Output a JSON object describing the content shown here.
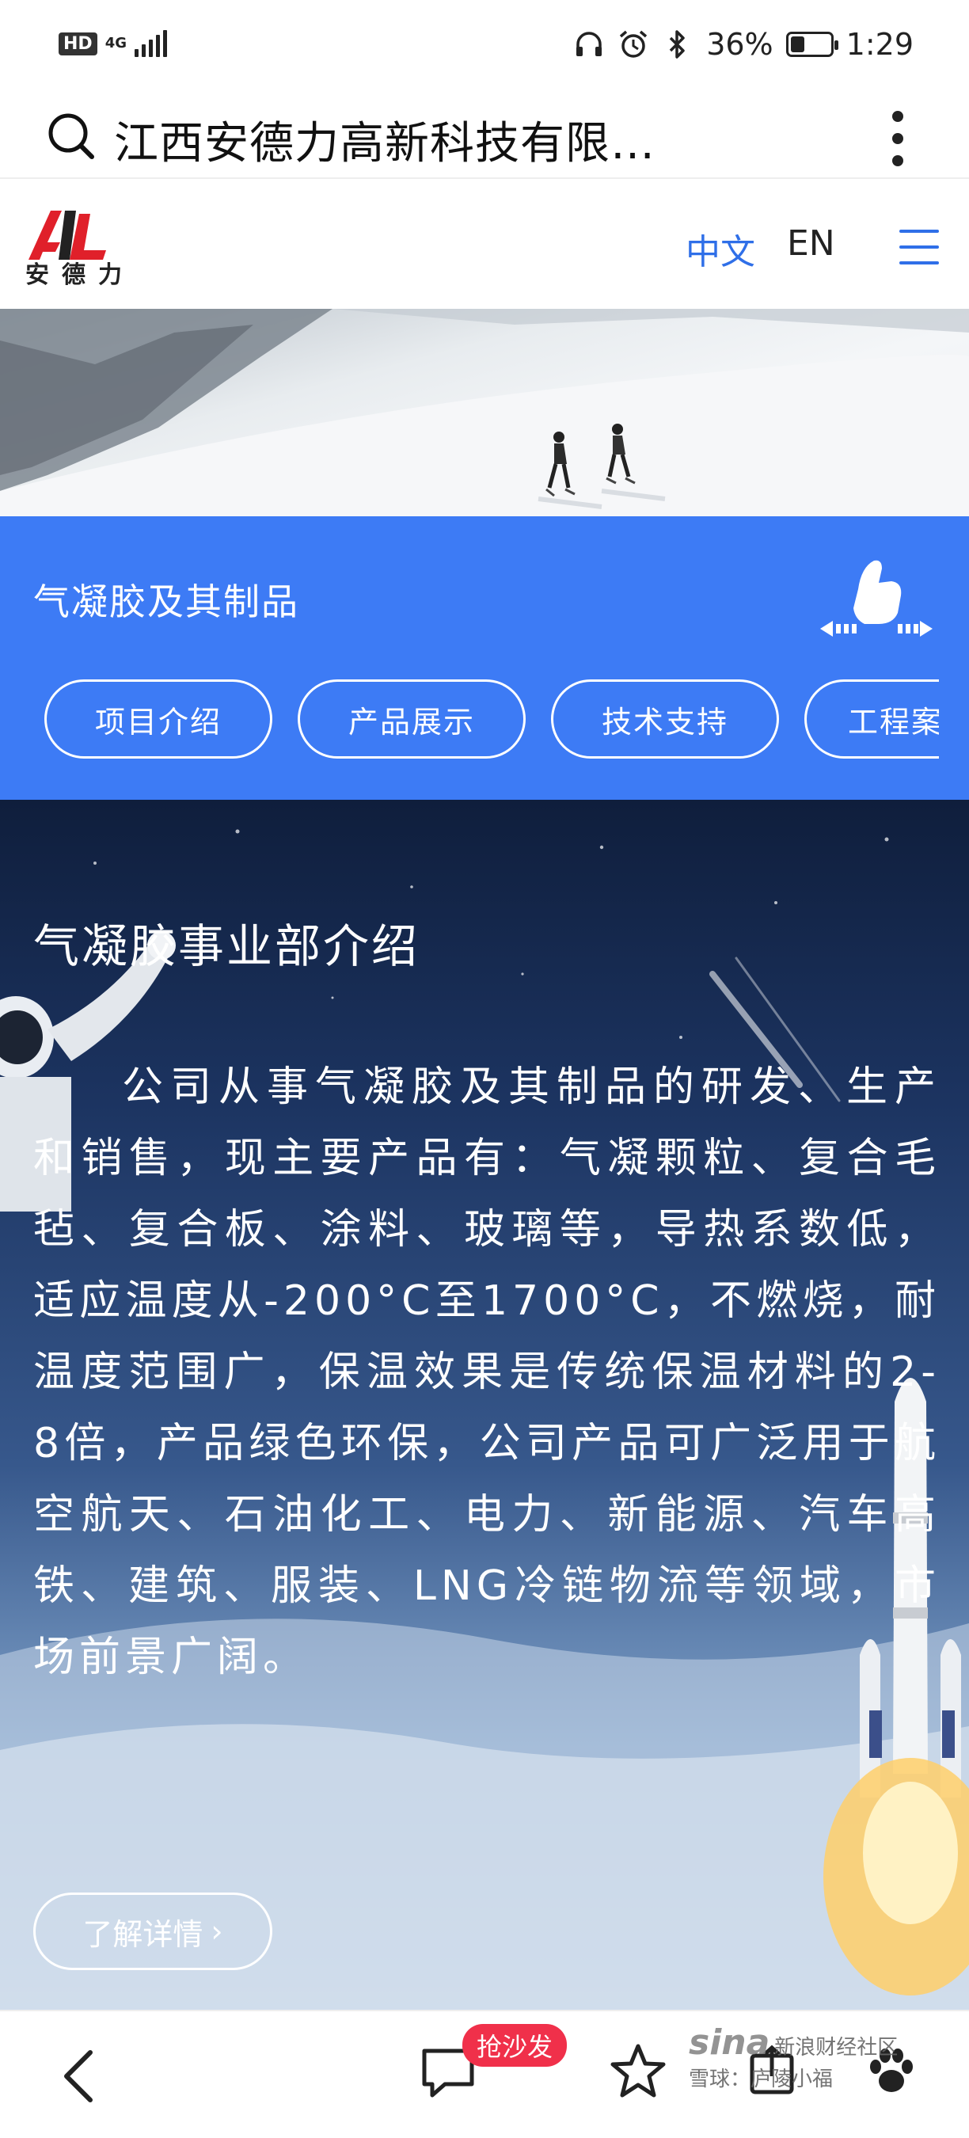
{
  "status_bar": {
    "hd": "HD",
    "network": "4G",
    "battery": "36%",
    "battery_level": 0.36,
    "time": "1:29"
  },
  "browser": {
    "address_title": "江西安德力高新科技有限…"
  },
  "site": {
    "logo_text": "安德力",
    "lang_zh": "中文",
    "lang_en": "EN"
  },
  "section": {
    "title": "气凝胶及其制品",
    "tabs": [
      {
        "label": "项目介绍"
      },
      {
        "label": "产品展示"
      },
      {
        "label": "技术支持"
      },
      {
        "label": "工程案"
      }
    ]
  },
  "intro": {
    "title": "气凝胶事业部介绍",
    "body": "公司从事气凝胶及其制品的研发、生产和销售，现主要产品有：气凝颗粒、复合毛毡、复合板、涂料、玻璃等，导热系数低，适应温度从-200°C至1700°C，不燃烧，耐温度范围广，保温效果是传统保温材料的2-8倍，产品绿色环保，公司产品可广泛用于航空航天、石油化工、电力、新能源、汽车高铁、建筑、服装、LNG冷链物流等领域，市场前景广阔。",
    "more_button": "了解详情",
    "more_chevron": "›"
  },
  "bottom_nav": {
    "sofa_badge": "抢沙发",
    "watermark_brand": "sina",
    "watermark_line1": "新浪财经社区",
    "watermark_line2": "雪球：庐陵小福"
  },
  "colors": {
    "accent_blue": "#3d7bf5",
    "lang_active": "#2f6fe8",
    "logo_red": "#e0202a",
    "badge_red": "#f0304a"
  }
}
